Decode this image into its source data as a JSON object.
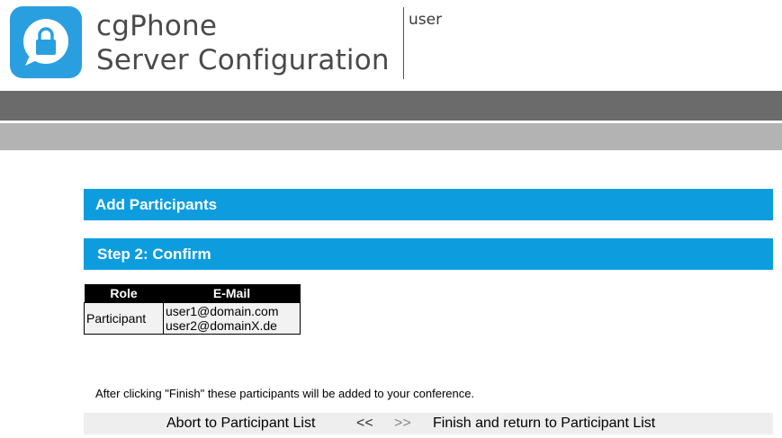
{
  "header": {
    "app_name": "cgPhone",
    "app_subtitle": "Server Configuration",
    "user": "user",
    "logo_icon": "chat-lock-icon",
    "brand_color": "#2a9fe0"
  },
  "sections": {
    "add_participants": "Add Participants",
    "step": "Step 2: Confirm"
  },
  "table": {
    "headers": [
      "Role",
      "E-Mail"
    ],
    "rows": [
      {
        "role": "Participant",
        "emails": [
          "user1@domain.com",
          "user2@domainX.de"
        ]
      }
    ]
  },
  "info_text": "After clicking \"Finish\" these participants will be added to your conference.",
  "nav": {
    "abort": "Abort to Participant List",
    "prev": "<<",
    "next": ">>",
    "finish": "Finish and return to Participant List"
  },
  "colors": {
    "section_blue": "#0d9ddf",
    "bar_dark": "#6b6b6b",
    "bar_light": "#b3b3b3"
  }
}
